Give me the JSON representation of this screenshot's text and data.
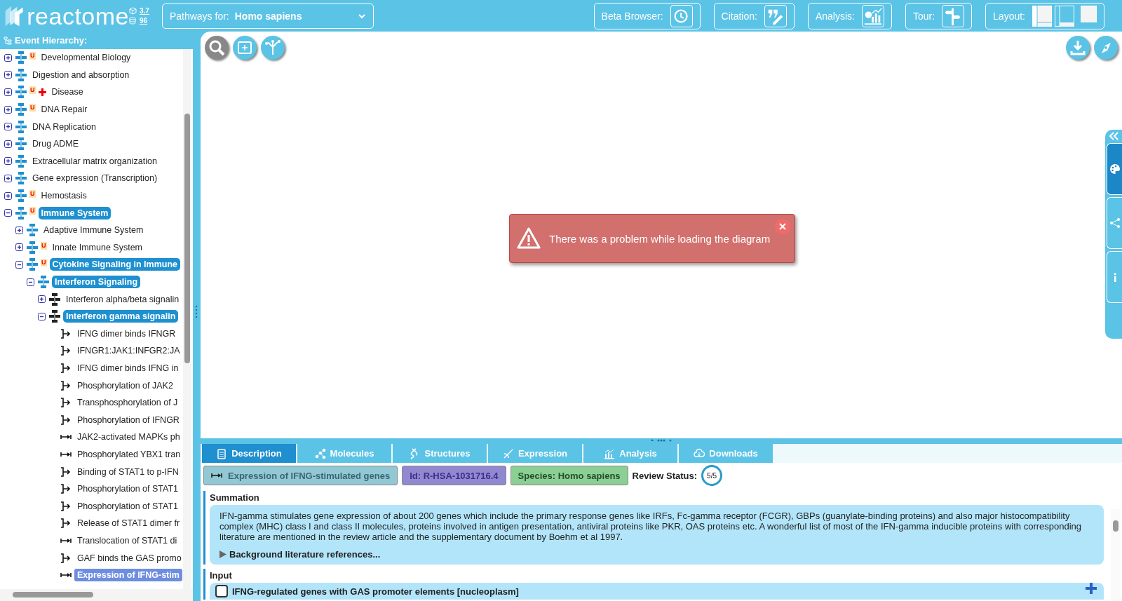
{
  "header": {
    "logo": "reactome",
    "version": "3.7",
    "release": "96",
    "species_selector": {
      "label": "Pathways for:",
      "value": "Homo sapiens"
    },
    "tools": [
      {
        "label": "Beta Browser:",
        "kind": "beta"
      },
      {
        "label": "Citation:",
        "kind": "citation"
      },
      {
        "label": "Analysis:",
        "kind": "analysis"
      },
      {
        "label": "Tour:",
        "kind": "tour"
      },
      {
        "label": "Layout:",
        "kind": "layout"
      }
    ]
  },
  "hierarchy": {
    "title": "Event Hierarchy:",
    "items": [
      {
        "label": "Developmental Biology",
        "kind": "pathway",
        "badge": "U",
        "disease": false,
        "expanded": false,
        "highlighted": false,
        "selected": false
      },
      {
        "label": "Digestion and absorption",
        "kind": "pathway",
        "disease": false,
        "expanded": false,
        "highlighted": false,
        "selected": false
      },
      {
        "label": "Disease",
        "kind": "pathway",
        "badge": "U",
        "disease": true,
        "expanded": false,
        "highlighted": false,
        "selected": false
      },
      {
        "label": "DNA Repair",
        "kind": "pathway",
        "badge": "U",
        "disease": false,
        "expanded": false,
        "highlighted": false,
        "selected": false
      },
      {
        "label": "DNA Replication",
        "kind": "pathway",
        "disease": false,
        "expanded": false,
        "highlighted": false,
        "selected": false
      },
      {
        "label": "Drug ADME",
        "kind": "pathway",
        "disease": false,
        "expanded": false,
        "highlighted": false,
        "selected": false
      },
      {
        "label": "Extracellular matrix organization",
        "kind": "pathway",
        "disease": false,
        "expanded": false,
        "highlighted": false,
        "selected": false
      },
      {
        "label": "Gene expression (Transcription)",
        "kind": "pathway",
        "disease": false,
        "expanded": false,
        "highlighted": false,
        "selected": false
      },
      {
        "label": "Hemostasis",
        "kind": "pathway",
        "badge": "U",
        "disease": false,
        "expanded": false,
        "highlighted": false,
        "selected": false
      },
      {
        "label": "Immune System",
        "kind": "pathway",
        "badge": "U",
        "disease": false,
        "expanded": true,
        "highlighted": true,
        "selected": false,
        "children": [
          {
            "label": "Adaptive Immune System",
            "kind": "pathway",
            "expanded": false,
            "highlighted": false,
            "selected": false
          },
          {
            "label": "Innate Immune System",
            "kind": "pathway",
            "badge": "U",
            "expanded": false,
            "highlighted": false,
            "selected": false
          },
          {
            "label": "Cytokine Signaling in Immune",
            "kind": "pathway",
            "badge": "U",
            "expanded": true,
            "highlighted": true,
            "selected": false,
            "children": [
              {
                "label": "Interferon Signaling",
                "kind": "pathway",
                "expanded": true,
                "highlighted": true,
                "selected": false,
                "children": [
                  {
                    "label": "Interferon alpha/beta signalin",
                    "kind": "subpathway",
                    "expanded": false,
                    "highlighted": false,
                    "selected": false
                  },
                  {
                    "label": "Interferon gamma signalin",
                    "kind": "subpathway",
                    "expanded": true,
                    "highlighted": true,
                    "selected": false,
                    "children": [
                      {
                        "label": "IFNG dimer binds IFNGR",
                        "kind": "reaction",
                        "highlighted": false,
                        "selected": false
                      },
                      {
                        "label": "IFNGR1:JAK1:INFGR2:JA",
                        "kind": "reaction",
                        "highlighted": false,
                        "selected": false
                      },
                      {
                        "label": "IFNG dimer binds IFNG in",
                        "kind": "reaction",
                        "highlighted": false,
                        "selected": false
                      },
                      {
                        "label": "Phosphorylation of JAK2",
                        "kind": "reaction",
                        "highlighted": false,
                        "selected": false
                      },
                      {
                        "label": "Transphosphorylation of J",
                        "kind": "reaction",
                        "highlighted": false,
                        "selected": false
                      },
                      {
                        "label": "Phosphorylation of IFNGR",
                        "kind": "reaction",
                        "highlighted": false,
                        "selected": false
                      },
                      {
                        "label": "JAK2-activated MAPKs ph",
                        "kind": "transition",
                        "highlighted": false,
                        "selected": false
                      },
                      {
                        "label": "Phosphorylated YBX1 tran",
                        "kind": "transition",
                        "highlighted": false,
                        "selected": false
                      },
                      {
                        "label": "Binding of STAT1 to p-IFN",
                        "kind": "reaction",
                        "highlighted": false,
                        "selected": false
                      },
                      {
                        "label": "Phosphorylation of STAT1",
                        "kind": "reaction",
                        "highlighted": false,
                        "selected": false
                      },
                      {
                        "label": "Phosphorylation of STAT1",
                        "kind": "reaction",
                        "highlighted": false,
                        "selected": false
                      },
                      {
                        "label": "Release of STAT1 dimer fr",
                        "kind": "reaction",
                        "highlighted": false,
                        "selected": false
                      },
                      {
                        "label": "Translocation of STAT1 di",
                        "kind": "transition",
                        "highlighted": false,
                        "selected": false
                      },
                      {
                        "label": "GAF binds the GAS promo",
                        "kind": "reaction",
                        "highlighted": false,
                        "selected": false
                      },
                      {
                        "label": "Expression of IFNG-stim",
                        "kind": "transition",
                        "highlighted": false,
                        "selected": true
                      }
                    ]
                  }
                ]
              }
            ]
          }
        ]
      }
    ]
  },
  "diagram": {
    "error": "There was a problem while loading the diagram",
    "side_tabs": [
      {
        "kind": "palette",
        "selected": true
      },
      {
        "kind": "share",
        "selected": false
      },
      {
        "kind": "info",
        "selected": false
      }
    ]
  },
  "details": {
    "tabs": [
      {
        "label": "Description",
        "kind": "description",
        "selected": true
      },
      {
        "label": "Molecules",
        "kind": "molecules",
        "selected": false
      },
      {
        "label": "Structures",
        "kind": "structures",
        "selected": false
      },
      {
        "label": "Expression",
        "kind": "expression",
        "selected": false
      },
      {
        "label": "Analysis",
        "kind": "analysis",
        "selected": false
      },
      {
        "label": "Downloads",
        "kind": "downloads",
        "selected": false
      }
    ],
    "event_name": "Expression of IFNG-stimulated genes",
    "id": "Id: R-HSA-1031716.4",
    "species": "Species: Homo sapiens",
    "review_label": "Review Status:",
    "review_value": "5/5",
    "summation_title": "Summation",
    "summation": "IFN-gamma stimulates gene expression of about 200 genes which include the primary response genes like IRFs, Fc-gamma receptor (FCGR), GBPs (guanylate-binding proteins) and also major histocompatibility complex (MHC) class I and class II molecules, proteins involved in antigen presentation, antiviral proteins like PKR, OAS proteins etc. A wonderful list of most of the IFN-gamma inducible proteins with corresponding literature are mentioned in the review article and the supplementary document by Boehm et al 1997.",
    "references": "Background literature references...",
    "input_title": "Input",
    "input": "IFNG-regulated genes with GAS promoter elements [nucleoplasm]"
  }
}
